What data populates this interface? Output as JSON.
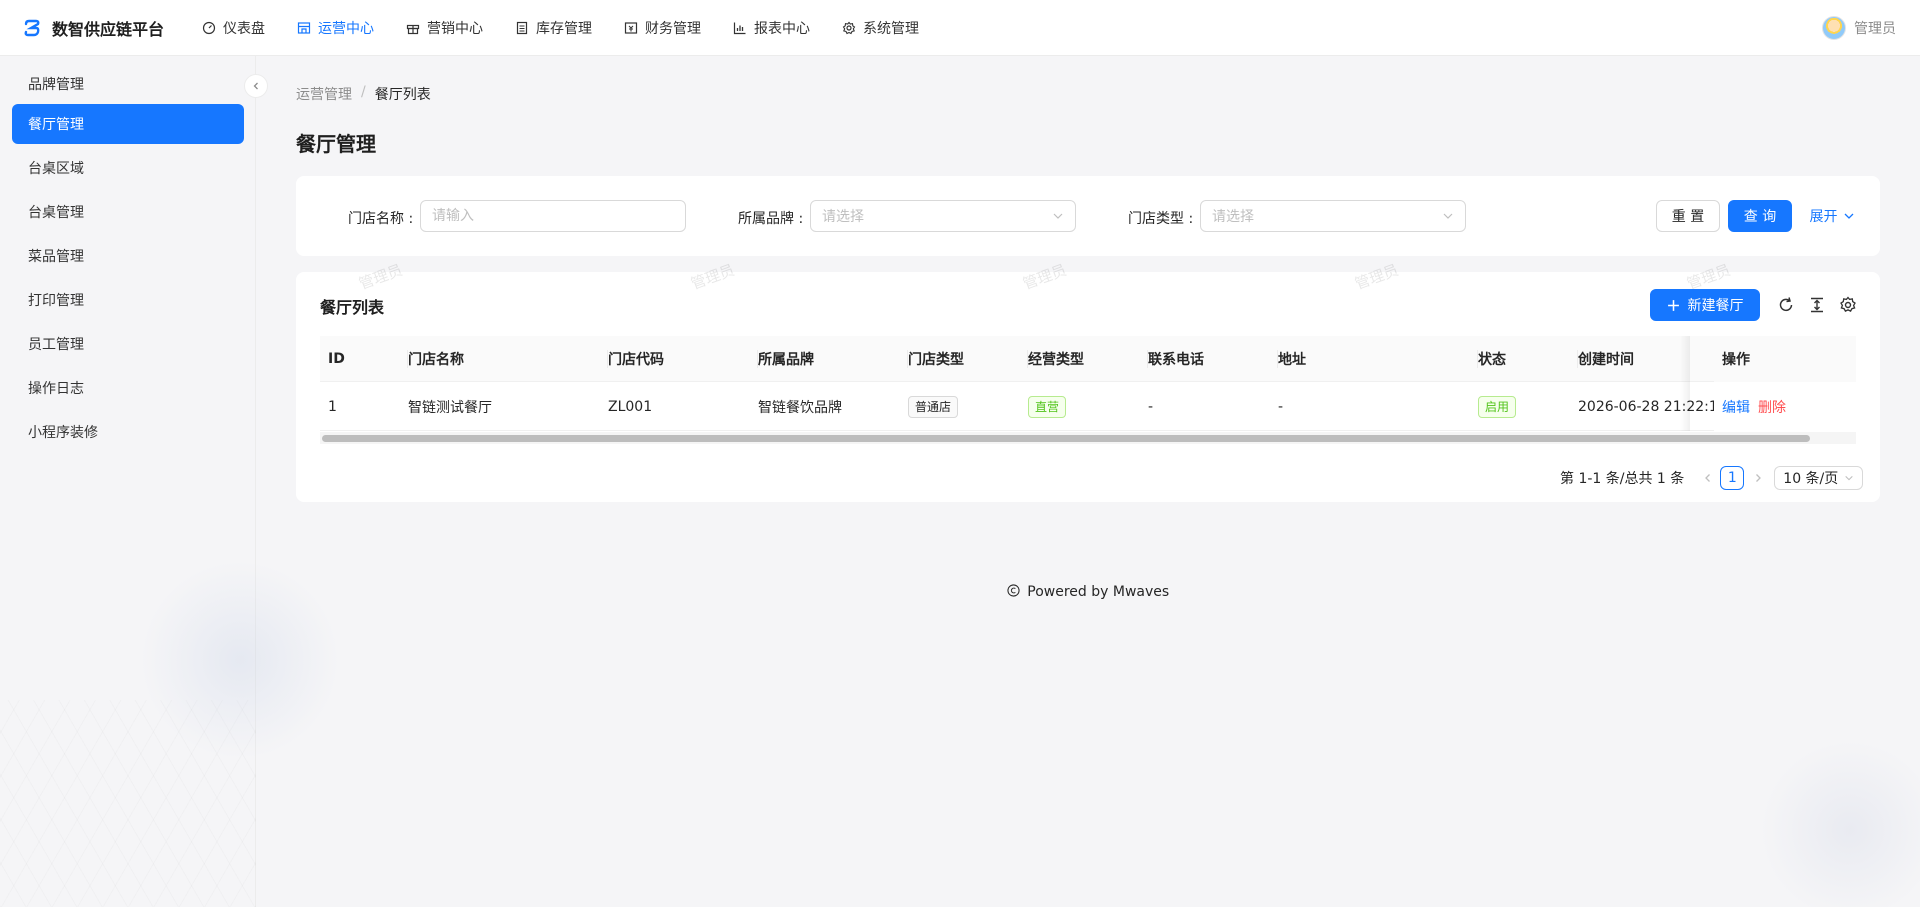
{
  "header": {
    "title": "数智供应链平台",
    "nav": [
      {
        "label": "仪表盘",
        "icon": "dashboard-icon"
      },
      {
        "label": "运营中心",
        "icon": "shop-icon",
        "active": true
      },
      {
        "label": "营销中心",
        "icon": "gift-icon"
      },
      {
        "label": "库存管理",
        "icon": "inventory-icon"
      },
      {
        "label": "财务管理",
        "icon": "finance-icon"
      },
      {
        "label": "报表中心",
        "icon": "chart-icon"
      },
      {
        "label": "系统管理",
        "icon": "gear-icon"
      }
    ],
    "user": "管理员"
  },
  "sidebar": {
    "items": [
      {
        "label": "品牌管理"
      },
      {
        "label": "餐厅管理",
        "active": true
      },
      {
        "label": "台桌区域"
      },
      {
        "label": "台桌管理"
      },
      {
        "label": "菜品管理"
      },
      {
        "label": "打印管理"
      },
      {
        "label": "员工管理"
      },
      {
        "label": "操作日志"
      },
      {
        "label": "小程序装修"
      }
    ]
  },
  "breadcrumb": {
    "parent": "运营管理",
    "separator": "/",
    "current": "餐厅列表"
  },
  "page_title": "餐厅管理",
  "filters": {
    "store_name_label": "门店名称 :",
    "store_name_placeholder": "请输入",
    "brand_label": "所属品牌 :",
    "brand_placeholder": "请选择",
    "store_type_label": "门店类型 :",
    "store_type_placeholder": "请选择",
    "reset_label": "重 置",
    "query_label": "查 询",
    "expand_label": "展开"
  },
  "table": {
    "title": "餐厅列表",
    "new_button_label": "新建餐厅",
    "watermark": "管理员",
    "columns": [
      "ID",
      "门店名称",
      "门店代码",
      "所属品牌",
      "门店类型",
      "经营类型",
      "联系电话",
      "地址",
      "状态",
      "创建时间",
      "操作"
    ],
    "rows": [
      {
        "id": "1",
        "name": "智链测试餐厅",
        "code": "ZL001",
        "brand": "智链餐饮品牌",
        "store_type": "普通店",
        "business_type": "直营",
        "phone": "-",
        "address": "-",
        "status": "启用",
        "created_at": "2026-06-28 21:22:1",
        "actions": {
          "edit": "编辑",
          "delete": "删除"
        }
      }
    ],
    "pagination": {
      "summary": "第 1-1 条/总共 1 条",
      "current_page": "1",
      "page_size": "10 条/页"
    }
  },
  "footer": {
    "text": "Powered by Mwaves"
  },
  "colors": {
    "primary": "#1677ff",
    "danger": "#ff4d4f",
    "success": "#52c41a"
  }
}
